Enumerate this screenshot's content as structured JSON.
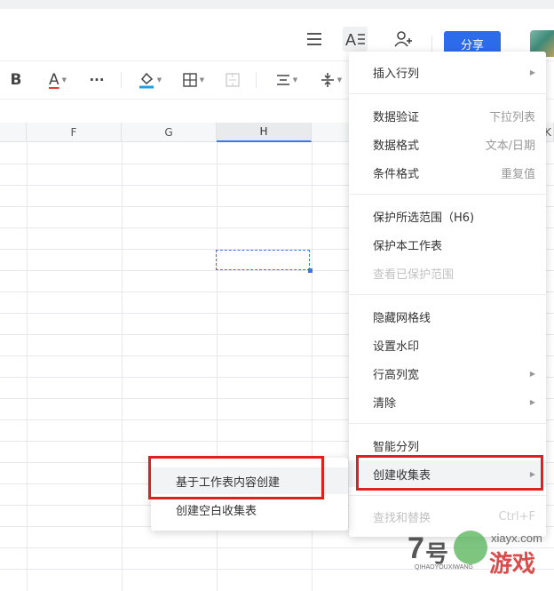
{
  "header": {
    "share_label": "分享",
    "icons": [
      "menu-icon",
      "text-format-icon",
      "add-user-icon"
    ]
  },
  "toolbar": {
    "items": [
      "bold-icon",
      "font-color-icon",
      "more-icon",
      "fill-color-icon",
      "border-icon",
      "merge-cells-icon",
      "align-icon",
      "vertical-align-icon"
    ],
    "bold": "B",
    "font_color": "A",
    "more": "···",
    "accent_font_color": "#e53935",
    "accent_fill_color": "#1aa0e8"
  },
  "sheet": {
    "columns": [
      "F",
      "G",
      "H"
    ],
    "active_column": "H",
    "partial_column": "K",
    "selected_cell": "H6"
  },
  "menu": {
    "groups": [
      [
        {
          "label": "插入行列",
          "submenu": true
        }
      ],
      [
        {
          "label": "数据验证",
          "shortcut": "下拉列表"
        },
        {
          "label": "数据格式",
          "shortcut": "文本/日期"
        },
        {
          "label": "条件格式",
          "shortcut": "重复值"
        }
      ],
      [
        {
          "label": "保护所选范围（H6)"
        },
        {
          "label": "保护本工作表"
        },
        {
          "label": "查看已保护范围",
          "disabled": true
        }
      ],
      [
        {
          "label": "隐藏网格线"
        },
        {
          "label": "设置水印"
        },
        {
          "label": "行高列宽",
          "submenu": true
        },
        {
          "label": "清除",
          "submenu": true
        }
      ],
      [
        {
          "label": "智能分列"
        },
        {
          "label": "创建收集表",
          "submenu": true,
          "highlighted": true
        }
      ],
      [
        {
          "label": "查找和替换",
          "shortcut": "Ctrl+F",
          "disabled": true
        }
      ]
    ]
  },
  "submenu": {
    "items": [
      {
        "label": "基于工作表内容创建",
        "highlighted": true
      },
      {
        "label": "创建空白收集表"
      }
    ]
  },
  "watermark": {
    "number": "7",
    "char1": "号",
    "big": "游戏",
    "site": "xiayx.com",
    "pinyin": "QIHAOYOUXIWANG"
  },
  "colors": {
    "brand_blue": "#2c6bea",
    "highlight_red": "#e0201e",
    "selection_blue": "#3a76f0"
  }
}
